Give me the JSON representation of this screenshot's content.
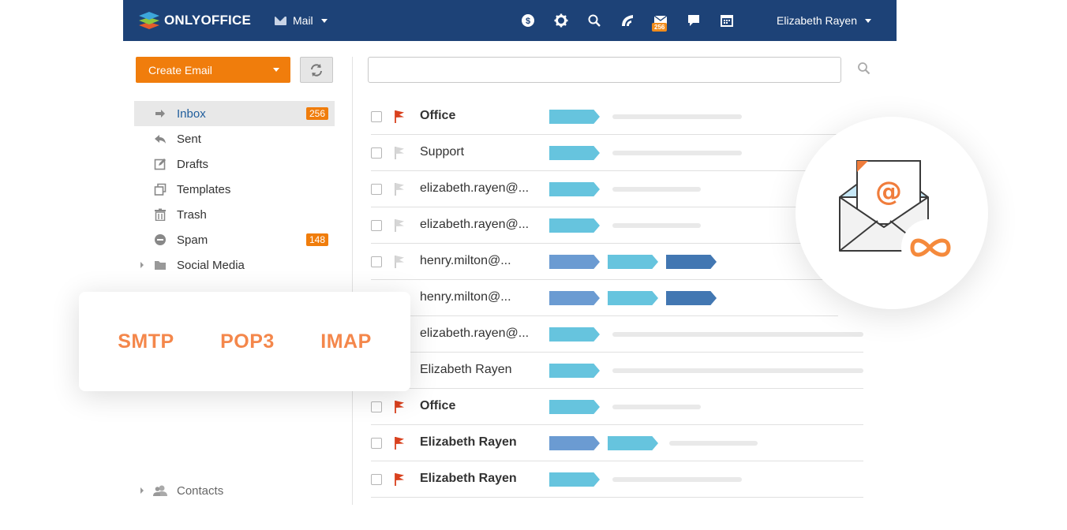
{
  "header": {
    "brand": "ONLYOFFICE",
    "module": "Mail",
    "mail_badge": "256",
    "user_name": "Elizabeth Rayen",
    "icons": [
      "dollar-icon",
      "gear-icon",
      "search-icon",
      "feed-icon",
      "mail-icon",
      "chat-icon",
      "calendar-icon"
    ]
  },
  "sidebar": {
    "create_label": "Create Email",
    "folders": [
      {
        "label": "Inbox",
        "count": "256",
        "icon": "arrow-right-icon"
      },
      {
        "label": "Sent",
        "count": "",
        "icon": "reply-icon"
      },
      {
        "label": "Drafts",
        "count": "",
        "icon": "edit-icon"
      },
      {
        "label": "Templates",
        "count": "",
        "icon": "copy-icon"
      },
      {
        "label": "Trash",
        "count": "",
        "icon": "trash-icon"
      },
      {
        "label": "Spam",
        "count": "148",
        "icon": "block-icon"
      },
      {
        "label": "Social Media",
        "count": "",
        "icon": "folder-icon"
      }
    ],
    "contacts_label": "Contacts"
  },
  "search": {
    "placeholder": ""
  },
  "messages": [
    {
      "sender": "Office",
      "bold": true,
      "flagged": true
    },
    {
      "sender": "Support",
      "bold": false,
      "flagged": false
    },
    {
      "sender": "elizabeth.rayen@...",
      "bold": false,
      "flagged": false
    },
    {
      "sender": "elizabeth.rayen@...",
      "bold": false,
      "flagged": false
    },
    {
      "sender": "henry.milton@...",
      "bold": false,
      "flagged": false
    },
    {
      "sender": "henry.milton@...",
      "bold": false,
      "flagged": false
    },
    {
      "sender": "elizabeth.rayen@...",
      "bold": false,
      "flagged": false
    },
    {
      "sender": "Elizabeth Rayen",
      "bold": false,
      "flagged": false
    },
    {
      "sender": "Office",
      "bold": true,
      "flagged": true
    },
    {
      "sender": "Elizabeth Rayen",
      "bold": true,
      "flagged": true
    },
    {
      "sender": "Elizabeth Rayen",
      "bold": true,
      "flagged": true
    }
  ],
  "protocols": [
    "SMTP",
    "POP3",
    "IMAP"
  ],
  "colors": {
    "header_bg": "#1d4277",
    "accent_orange": "#f07d0c",
    "active_link": "#1f5d9c",
    "tag_cyan": "#66c4de",
    "tag_blue": "#6b9bd2",
    "tag_navy": "#4277b2",
    "flag_red": "#d9411e",
    "protocol_orange": "#f4874b"
  }
}
